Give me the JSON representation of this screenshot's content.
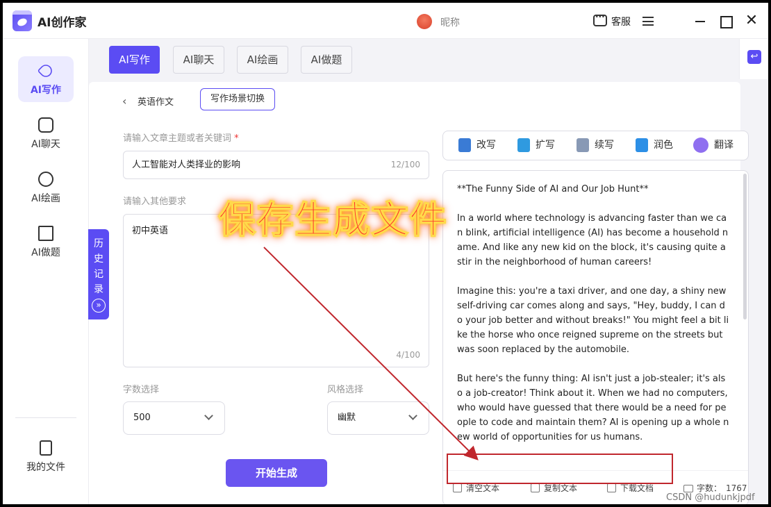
{
  "app": {
    "title": "AI创作家",
    "nickname": "昵称",
    "service_label": "客服",
    "close_glyph": "✕"
  },
  "sidebar": {
    "items": [
      {
        "label": "AI写作"
      },
      {
        "label": "AI聊天"
      },
      {
        "label": "AI绘画"
      },
      {
        "label": "AI做题"
      }
    ],
    "files_label": "我的文件",
    "history_label": "历史记录",
    "history_arrow": "»"
  },
  "tabs": [
    {
      "label": "AI写作"
    },
    {
      "label": "AI聊天"
    },
    {
      "label": "AI绘画"
    },
    {
      "label": "AI做题"
    }
  ],
  "breadcrumb": {
    "back": "‹",
    "label": "英语作文",
    "scene_button": "写作场景切换"
  },
  "form": {
    "topic_label": "请输入文章主题或者关键词",
    "topic_required": "*",
    "topic_value": "人工智能对人类择业的影响",
    "topic_count": "12/100",
    "requirements_label": "请输入其他要求",
    "requirements_value": "初中英语",
    "requirements_count": "4/100",
    "word_count_label": "字数选择",
    "word_count_value": "500",
    "style_label": "风格选择",
    "style_value": "幽默",
    "generate_label": "开始生成"
  },
  "toolbar": {
    "rewrite": "改写",
    "expand": "扩写",
    "continue": "续写",
    "polish": "润色",
    "translate": "翻译"
  },
  "output": {
    "text": "**The Funny Side of AI and Our Job Hunt**\n\nIn a world where technology is advancing faster than we can blink, artificial intelligence (AI) has become a household name. And like any new kid on the block, it's causing quite a stir in the neighborhood of human careers!\n\nImagine this: you're a taxi driver, and one day, a shiny new self-driving car comes along and says, \"Hey, buddy, I can do your job better and without breaks!\" You might feel a bit like the horse who once reigned supreme on the streets but was soon replaced by the automobile.\n\nBut here's the funny thing: AI isn't just a job-stealer; it's also a job-creator! Think about it. When we had no computers, who would have guessed that there would be a need for people to code and maintain them? AI is opening up a whole new world of opportunities for us humans.",
    "clear_label": "清空文本",
    "copy_label": "复制文本",
    "download_label": "下载文档",
    "word_count_prefix": "字数：",
    "word_count_value": "1767"
  },
  "annotation": {
    "text": "保存生成文件",
    "color": "#ff2b2b"
  },
  "watermark": "CSDN @hudunkjpdf",
  "colors": {
    "accent": "#5b4cf3",
    "highlight_box": "#c0272d"
  }
}
